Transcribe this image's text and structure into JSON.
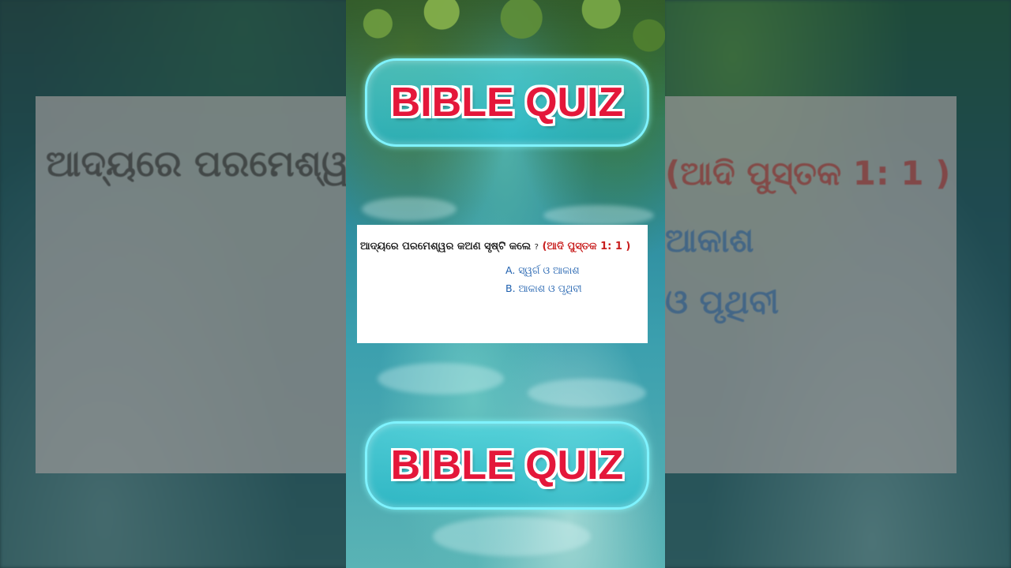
{
  "banner": {
    "top_label": "BIBLE QUIZ",
    "bottom_label": "BIBLE QUIZ"
  },
  "quiz": {
    "question": "ଆଦ୍ୟରେ ପରମେଶ୍ୱର କଅଣ ସୃଷ୍ଟି କଲେ",
    "question_mark": "?",
    "reference": "(ଆଦି ପୁସ୍ତକ 1: 1 )",
    "options": [
      {
        "letter": "A.",
        "text": "ସ୍ୱର୍ଗ ଓ ଆକାଶ"
      },
      {
        "letter": "B.",
        "text": "ଆକାଶ ଓ ପୃଥିବୀ"
      }
    ]
  },
  "background_blur": {
    "question_fragment": "ଆଦ୍ୟରେ ପରମେଶ୍ୱର",
    "reference_fragment": "(ଆଦି ପୁସ୍ତକ 1: 1 )",
    "option_a_fragment": "ଆକାଶ",
    "option_b_fragment": "ଓ ପୃଥିବୀ"
  },
  "colors": {
    "banner_text": "#e4173a",
    "banner_border": "#7ff3ff",
    "reference_text": "#c81e1e",
    "option_text": "#1d5fae"
  }
}
